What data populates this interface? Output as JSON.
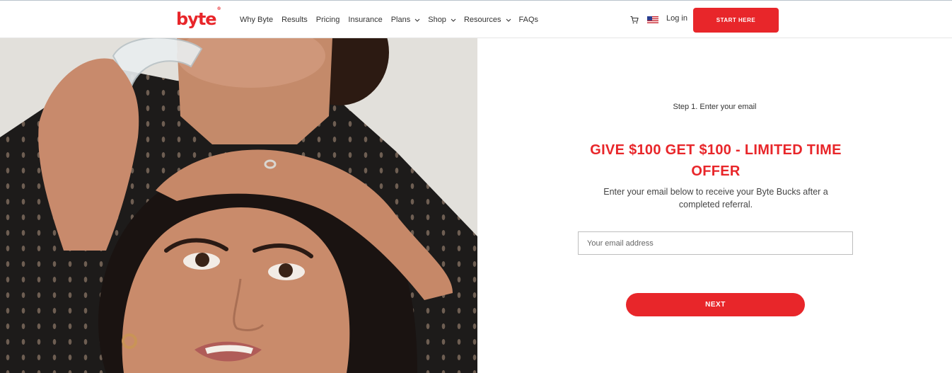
{
  "header": {
    "logo_text": "byte",
    "logo_mark": "®",
    "nav": [
      {
        "label": "Why Byte",
        "has_dropdown": false
      },
      {
        "label": "Results",
        "has_dropdown": false
      },
      {
        "label": "Pricing",
        "has_dropdown": false
      },
      {
        "label": "Insurance",
        "has_dropdown": false
      },
      {
        "label": "Plans",
        "has_dropdown": true
      },
      {
        "label": "Shop",
        "has_dropdown": true
      },
      {
        "label": "Resources",
        "has_dropdown": true
      },
      {
        "label": "FAQs",
        "has_dropdown": false
      }
    ],
    "cart_icon": "cart-icon",
    "flag_icon": "us-flag-icon",
    "login_label": "Log in",
    "cta_label": "START HERE"
  },
  "form": {
    "step_label": "Step 1. Enter your email",
    "headline": "GIVE $100 GET $100 - LIMITED TIME OFFER",
    "subtext": "Enter your email below to receive your Byte Bucks after a completed referral.",
    "email_placeholder": "Your email address",
    "email_value": "",
    "next_label": "NEXT"
  },
  "colors": {
    "brand_red": "#e8262a",
    "text": "#333333"
  }
}
